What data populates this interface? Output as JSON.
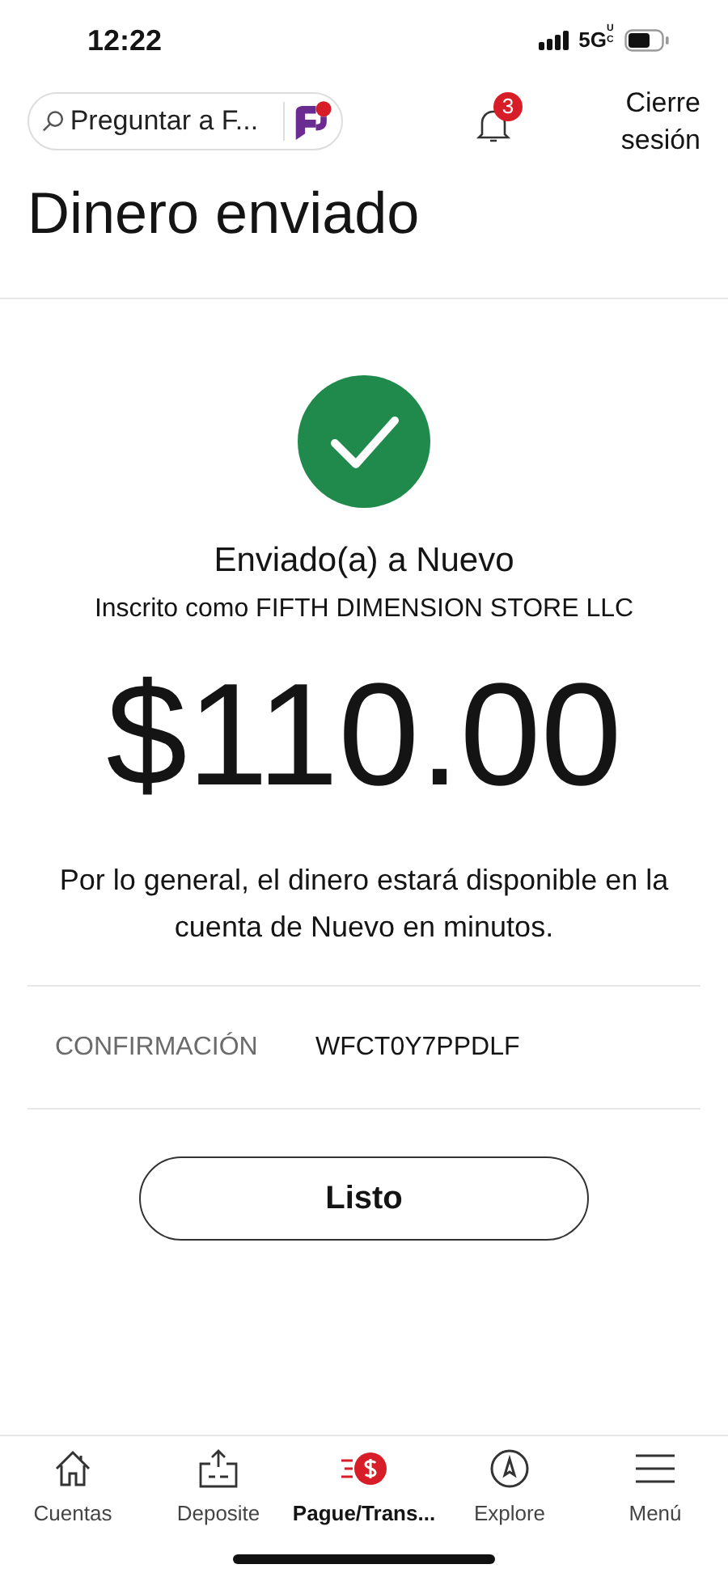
{
  "status_bar": {
    "time": "12:22",
    "network": "5G",
    "network_sub": "UC"
  },
  "header": {
    "search": {
      "placeholder": "Preguntar a F..."
    },
    "notifications": {
      "count": "3"
    },
    "logout": "Cierre sesión"
  },
  "title": "Dinero enviado",
  "result": {
    "heading": "Enviado(a) a Nuevo",
    "subheading": "Inscrito como FIFTH DIMENSION STORE LLC",
    "amount": "$110.00",
    "message": "Por lo general, el dinero estará disponible en la cuenta de Nuevo en minutos."
  },
  "confirmation": {
    "label": "CONFIRMACIÓN",
    "value": "WFCT0Y7PPDLF"
  },
  "done_button": "Listo",
  "tabs": [
    {
      "kind": "home",
      "label": "Cuentas",
      "selected": false
    },
    {
      "kind": "deposit",
      "label": "Deposite",
      "selected": false
    },
    {
      "kind": "pay",
      "label": "Pague/Trans...",
      "selected": true
    },
    {
      "kind": "explore",
      "label": "Explore",
      "selected": false
    },
    {
      "kind": "menu",
      "label": "Menú",
      "selected": false
    }
  ]
}
